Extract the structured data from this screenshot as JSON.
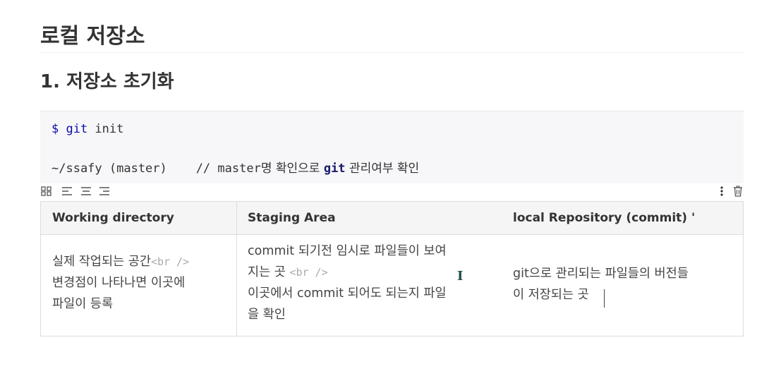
{
  "heading1": "로컬 저장소",
  "heading2": "1. 저장소 초기화",
  "code": {
    "line1_prompt": "$ git",
    "line1_cmd": " init",
    "line2_path": "~/ssafy (master)    // master",
    "line2_kr1": "명 확인으로 ",
    "line2_git": "git",
    "line2_kr2": " 관리여부 확인"
  },
  "toolbar": {
    "icons": [
      "table-grid-icon",
      "align-left-icon",
      "align-center-icon",
      "align-right-icon",
      "more-vertical-icon",
      "trash-icon"
    ]
  },
  "table": {
    "headers": [
      "Working directory",
      "Staging Area",
      "local Repository (commit) '"
    ],
    "cells": {
      "c1_line1": "실제 작업되는 공간",
      "c1_br": "<br />",
      "c1_line2": "변경점이 나타나면 이곳에",
      "c1_line3": "파일이 등록",
      "c2_line1": "commit 되기전 임시로 파일들이 보여",
      "c2_line2": "지는 곳 ",
      "c2_br": "<br />",
      "c2_line3": "이곳에서 commit 되어도 되는지 파일",
      "c2_line4": "을 확인",
      "c3_line1": "git으로 관리되는 파일들의 버전들",
      "c3_line2": "이 저장되는 곳"
    }
  },
  "text_cursor_glyph": "I"
}
